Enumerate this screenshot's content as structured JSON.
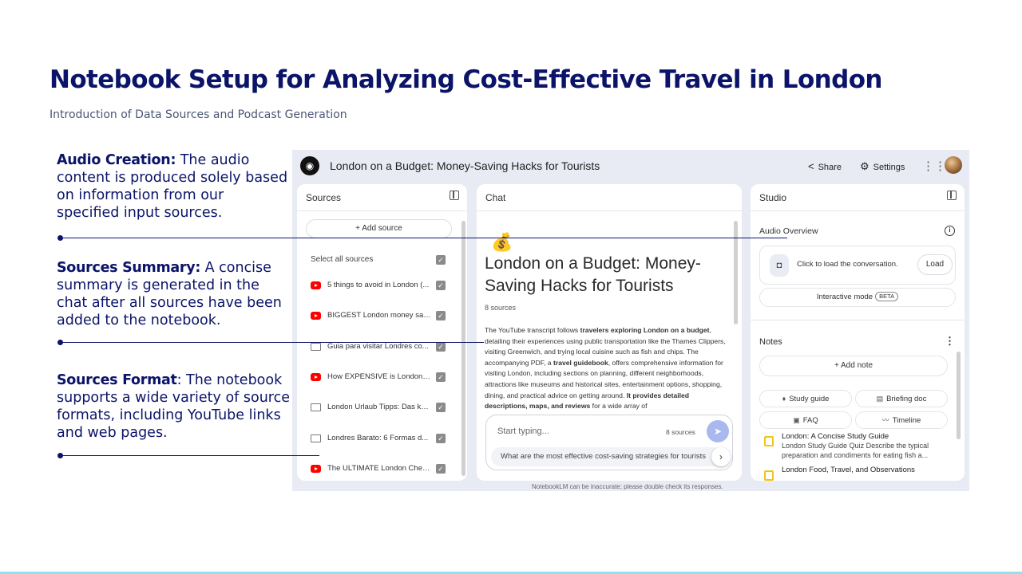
{
  "slide": {
    "title": "Notebook Setup for Analyzing Cost-Effective Travel in London",
    "subtitle": "Introduction of Data Sources and Podcast Generation"
  },
  "callouts": [
    {
      "heading": "Audio Creation:",
      "text": " The audio content is produced solely based on information from our specified input sources."
    },
    {
      "heading": "Sources Summary:",
      "text": " A concise summary is generated in the chat after all sources have been added to the notebook."
    },
    {
      "heading": "Sources Format",
      "text": ": The notebook supports a wide variety of source formats, including YouTube links and web pages."
    }
  ],
  "colors": {
    "title": "#0b1468",
    "accent_bar": "#8ee3ea",
    "send": "#a9b9f0",
    "youtube": "#ff0000",
    "note": "#f2c419"
  },
  "app": {
    "title": "London on a Budget: Money-Saving Hacks for Tourists",
    "share_label": "Share",
    "settings_label": "Settings",
    "icons": {
      "share": "share-icon",
      "settings": "gear-icon",
      "apps": "apps-grid-icon"
    }
  },
  "sources_panel": {
    "heading": "Sources",
    "add_source": "+ Add source",
    "select_all": "Select all sources",
    "items": [
      {
        "label": "5 things to avoid in London (...",
        "type": "youtube"
      },
      {
        "label": "BIGGEST London money sav...",
        "type": "youtube"
      },
      {
        "label": "Guia para visitar Londres co...",
        "type": "web"
      },
      {
        "label": "How EXPENSIVE is London? ...",
        "type": "youtube"
      },
      {
        "label": "London Urlaub Tipps: Das ka...",
        "type": "web"
      },
      {
        "label": "Londres Barato: 6 Formas d...",
        "type": "web"
      },
      {
        "label": "The ULTIMATE London Chea...",
        "type": "youtube"
      }
    ]
  },
  "chat_panel": {
    "heading": "Chat",
    "emoji": "💰",
    "title": "London on a Budget: Money-Saving Hacks for Tourists",
    "source_count": "8 sources",
    "summary": {
      "p1": "The YouTube transcript follows ",
      "b1": "travelers exploring London on a budget",
      "p2": ", detailing their experiences using public transportation like the Thames Clippers, visiting Greenwich, and trying local cuisine such as fish and chips. The accompanying PDF, a ",
      "b2": "travel guidebook",
      "p3": ", offers comprehensive information for visiting London, including sections on planning, different neighborhoods, attractions like museums and historical sites, entertainment options, shopping, dining, and practical advice on getting around. ",
      "b3": "It provides detailed descriptions, maps, and reviews",
      "p4": " for a wide array of"
    },
    "input_placeholder": "Start typing...",
    "input_count": "8 sources",
    "suggestion": "What are the most effective cost-saving strategies for tourists",
    "disclaimer": "NotebookLM can be inaccurate; please double check its responses."
  },
  "studio_panel": {
    "heading": "Studio",
    "audio_overview": "Audio Overview",
    "audio_text": "Click to load the conversation.",
    "load": "Load",
    "interactive": "Interactive mode",
    "beta": "BETA",
    "notes_heading": "Notes",
    "add_note": "+ Add note",
    "chips": [
      "Study guide",
      "Briefing doc",
      "FAQ",
      "Timeline"
    ],
    "notes": [
      {
        "title": "London: A Concise Study Guide",
        "desc": "London Study Guide Quiz Describe the typical preparation and condiments for eating fish a..."
      },
      {
        "title": "London Food, Travel, and Observations",
        "desc": ""
      }
    ]
  }
}
